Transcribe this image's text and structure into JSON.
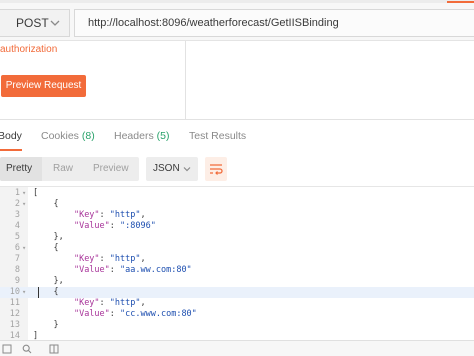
{
  "request": {
    "method": "POST",
    "url": "http://localhost:8096/weatherforecast/GetIISBinding"
  },
  "auth": {
    "label": "authorization",
    "preview_button": "Preview Request"
  },
  "response_tabs": [
    {
      "label": "Body",
      "count": ""
    },
    {
      "label": "Cookies",
      "count": "(8)"
    },
    {
      "label": "Headers",
      "count": "(5)"
    },
    {
      "label": "Test Results",
      "count": ""
    }
  ],
  "format": {
    "options": [
      "Pretty",
      "Raw",
      "Preview"
    ],
    "active": "Pretty",
    "language": "JSON"
  },
  "code": {
    "highlighted_line": 10,
    "lines": [
      {
        "n": "1",
        "fold": "▾",
        "indent": "",
        "text": "["
      },
      {
        "n": "2",
        "fold": "▾",
        "indent": "    ",
        "text": "{"
      },
      {
        "n": "3",
        "fold": "",
        "indent": "        ",
        "key": "\"Key\"",
        "val": "\"http\"",
        "tail": ","
      },
      {
        "n": "4",
        "fold": "",
        "indent": "        ",
        "key": "\"Value\"",
        "val": "\":8096\"",
        "tail": ""
      },
      {
        "n": "5",
        "fold": "",
        "indent": "    ",
        "text": "},"
      },
      {
        "n": "6",
        "fold": "▾",
        "indent": "    ",
        "text": "{"
      },
      {
        "n": "7",
        "fold": "",
        "indent": "        ",
        "key": "\"Key\"",
        "val": "\"http\"",
        "tail": ","
      },
      {
        "n": "8",
        "fold": "",
        "indent": "        ",
        "key": "\"Value\"",
        "val": "\"aa.ww.com:80\"",
        "tail": ""
      },
      {
        "n": "9",
        "fold": "",
        "indent": "    ",
        "text": "},"
      },
      {
        "n": "10",
        "fold": "▾",
        "indent": "    ",
        "text": "{"
      },
      {
        "n": "11",
        "fold": "",
        "indent": "        ",
        "key": "\"Key\"",
        "val": "\"http\"",
        "tail": ","
      },
      {
        "n": "12",
        "fold": "",
        "indent": "        ",
        "key": "\"Value\"",
        "val": "\"cc.www.com:80\"",
        "tail": ""
      },
      {
        "n": "13",
        "fold": "",
        "indent": "    ",
        "text": "}"
      },
      {
        "n": "14",
        "fold": "",
        "indent": "",
        "text": "]"
      }
    ]
  },
  "colors": {
    "accent": "#f26b3a",
    "count": "#2aa36b",
    "json_key": "#a8359a",
    "json_string": "#1e4fb0"
  },
  "icons": [
    "chevron-down-icon",
    "wrap-lines-icon",
    "console-icon",
    "search-icon",
    "layout-icon"
  ]
}
